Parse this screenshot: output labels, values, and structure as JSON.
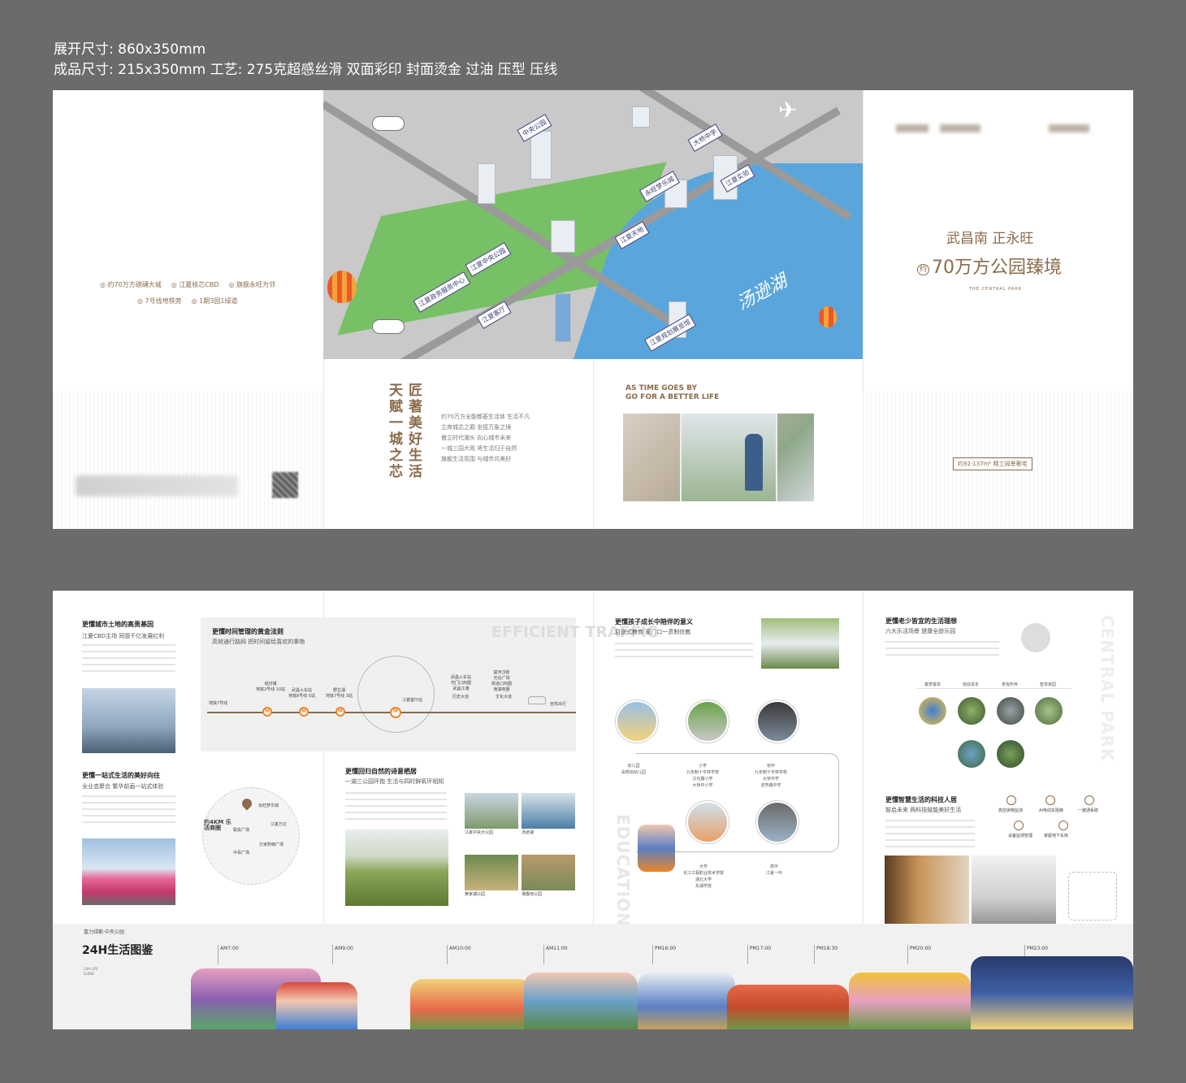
{
  "spec": {
    "line1": "展开尺寸: 860x350mm",
    "line2": "成品尺寸: 215x350mm    工艺: 275克超感丝滑  双面彩印 封面烫金 过油 压型 压线"
  },
  "outside": {
    "features_row1": [
      "约70万方磅礴大城",
      "江夏核芯CBD",
      "旗舰永旺为邻"
    ],
    "features_row2": [
      "7号线地铁旁",
      "1期3园1绿道"
    ],
    "map": {
      "signs": [
        "中央公园",
        "大桥中学",
        "江夏实验",
        "永旺梦乐城",
        "江夏天地",
        "江夏中央公园",
        "江夏政务服务中心",
        "江夏客厅",
        "江夏规划展览馆"
      ],
      "lake_label": "汤逊湖"
    },
    "inside_vertical_a": "天赋一城之芯",
    "inside_vertical_b": "匠著美好生活",
    "body_lines": [
      "约70万方全能都荟生活体 生活不凡",
      "立席城芯之巅 坐揽万象之境",
      "傲立时代潮头 向心城市未来",
      "一城三园大观 将生活归于自然",
      "旗舰生活氛围 与城市共美好"
    ],
    "eng_title_1": "AS TIME GOES BY",
    "eng_title_2": "GO FOR A BETTER LIFE",
    "cover": {
      "slogan": "武昌南 正永旺",
      "prefix": "约",
      "headline": "70万方公园臻境",
      "english": "THE CENTRAL PARK",
      "tag": "约92-137m² 精工阔景奢宅"
    }
  },
  "inside": {
    "s1": {
      "title": "更懂城市土地的高贵基因",
      "sub": "江夏CBD主场 同感千亿发展红利"
    },
    "s2": {
      "title": "更懂时间管理的黄金法则",
      "sub": "高效通行路网 把时间留给喜欢的事物",
      "ghost": "EFFICIENT TRAFFIC"
    },
    "metro": {
      "line_name": "地铁7号线",
      "stations": [
        {
          "name": "纸坊镇",
          "note": "地铁2号线 10站"
        },
        {
          "name": "武昌火车站",
          "note": "地铁8号线 5站"
        },
        {
          "name": "野芷湖",
          "note": "地铁7号线 3站"
        }
      ],
      "center_station": "江夏客厅站",
      "right_1": "武昌火车站\n司门口商圈\n武昌江滩",
      "right_1_tag": "历史大道",
      "right_2": "楚河汉街\n光谷广场\n街道口商圈\n南湖商圈",
      "right_2_tag": "文化大道",
      "self_drive": "自驾出行"
    },
    "s3": {
      "title": "更懂一站式生活的美好向往",
      "sub": "全业态聚合 繁华前画一站式体验",
      "center": "约4KM 乐活商圈",
      "nodes": [
        "永旺梦乐城",
        "江夏万达",
        "联投广场",
        "中百广场",
        "万家购物广场"
      ]
    },
    "s4": {
      "title": "更懂回归自然的诗意栖居",
      "sub": "一湖三公园环抱 生活与四时鲜氧环相知",
      "parks": [
        "江夏中央大公园",
        "汤逊湖",
        "黄家湖公园",
        "谭鑫培公园"
      ]
    },
    "s5": {
      "title": "更懂孩子成长中陪伴的意义",
      "sub": "目送式教育 家门口一贯制优教",
      "stages": [
        "幼儿园",
        "小学",
        "初中",
        "大学",
        "高中"
      ],
      "schools": [
        "由规划幼儿园",
        "九年制十字林学校\n文化路小学\n大桥中小学",
        "九年制十字林学校\n大桥中学\n流芳路中学",
        "长江工程职业技术学院\n湖北大学\n东湖学院",
        "江夏一中"
      ],
      "ghost": "EDUCATION"
    },
    "s6": {
      "title": "更懂老少皆宜的生活理想",
      "sub": "六大乐活场景 健康全龄乐园",
      "tags": [
        "童梦童享",
        "悦动青年",
        "老有所养",
        "智享家园"
      ],
      "ghost": "CENTRAL PARK"
    },
    "s7": {
      "title": "更懂智慧生活的科技人居",
      "sub": "智启未来 两科技赋能美好生活",
      "items": [
        "高空抛物监测",
        "AI电动车阻梯",
        "一键通系统",
        "设备监测管理",
        "家庭地下车库"
      ]
    },
    "timeline": {
      "brand": "富力绿都·中央公园",
      "title": "24H生活图鉴",
      "sub": "24H LIFE\nGUIDE",
      "times": [
        "AM7:00",
        "AM9:00",
        "AM10:00",
        "AM11:00",
        "PM16:00",
        "PM17:00",
        "PM18:30",
        "PM20:00",
        "PM23:00"
      ]
    }
  },
  "colors": {
    "brand": "#8a6b4b",
    "background": "#6b6b6b",
    "lake": "#5aa6dc",
    "park": "#6fbf5a"
  }
}
